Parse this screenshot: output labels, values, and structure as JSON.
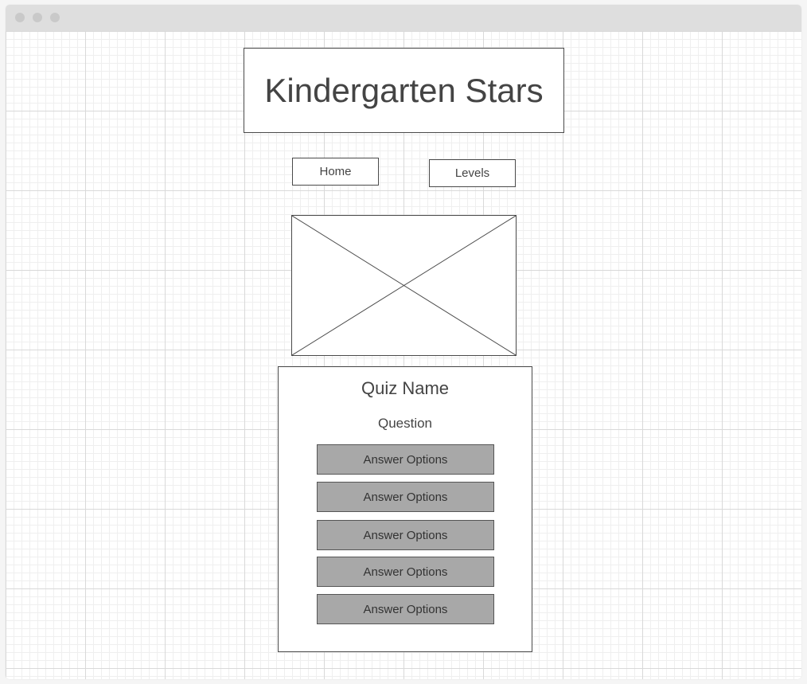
{
  "app": {
    "title": "Kindergarten Stars"
  },
  "nav": {
    "items": [
      {
        "label": "Home"
      },
      {
        "label": "Levels"
      }
    ]
  },
  "image": {
    "icon": "image-placeholder-icon"
  },
  "quiz": {
    "name": "Quiz Name",
    "question": "Question",
    "answers": [
      {
        "label": "Answer Options"
      },
      {
        "label": "Answer Options"
      },
      {
        "label": "Answer Options"
      },
      {
        "label": "Answer Options"
      },
      {
        "label": "Answer Options"
      }
    ]
  },
  "colors": {
    "answer_fill": "#a8a8a8",
    "border": "#4a4a4a",
    "text": "#444444"
  }
}
